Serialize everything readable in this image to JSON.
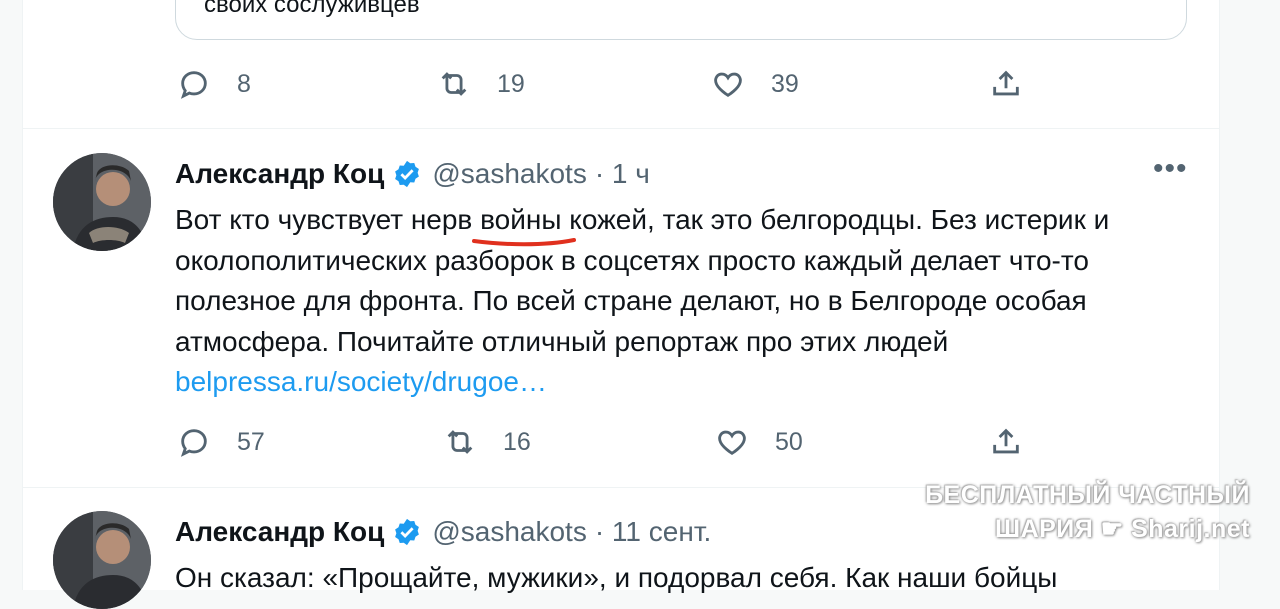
{
  "quote_card": {
    "text": "своих сослуживцев"
  },
  "tweet1_actions": {
    "replies": "8",
    "retweets": "19",
    "likes": "39"
  },
  "tweet2": {
    "name": "Александр Коц",
    "handle": "@sashakots",
    "time": "· 1 ч",
    "text_part1": "Вот кто чувствует нерв ",
    "text_underlined": "войны",
    "text_part2": " кожей, так это белгородцы. Без истерик и околополитических разборок в соцсетях просто каждый делает что-то полезное для фронта. По всей стране делают, но в Белгороде особая атмосфера. Почитайте отличный репортаж про этих людей ",
    "link": "belpressa.ru/society/drugoe…",
    "replies": "57",
    "retweets": "16",
    "likes": "50"
  },
  "tweet3": {
    "name": "Александр Коц",
    "handle": "@sashakots",
    "time": "· 11 сент.",
    "text": "Он сказал: «Прощайте, мужики», и подорвал себя. Как наши бойцы"
  },
  "more_icon": "•••",
  "watermark": {
    "line1": "БЕСПЛАТНЫЙ ЧАСТНЫЙ",
    "line2": "ШАРИЯ",
    "line2_site": "Sharij.net"
  },
  "colors": {
    "link": "#1d9bf0",
    "verified": "#1d9bf0",
    "underline": "#e0301e",
    "secondary": "#536471"
  }
}
